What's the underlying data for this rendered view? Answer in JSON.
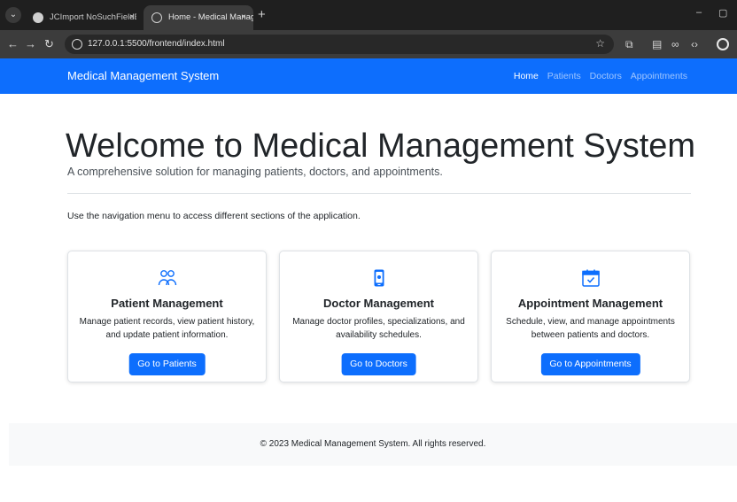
{
  "browser": {
    "tabs": [
      {
        "title": "JCImport NoSuchFieldError Fix",
        "close": "×",
        "active": false
      },
      {
        "title": "Home - Medical Management System",
        "close": "×",
        "active": true
      }
    ],
    "new_tab": "+",
    "url": "127.0.0.1:5500/frontend/index.html",
    "window_controls": {
      "minimize": "–",
      "restore": "▢"
    }
  },
  "navbar": {
    "brand": "Medical Management System",
    "links": [
      "Home",
      "Patients",
      "Doctors",
      "Appointments"
    ],
    "active_link": "Home",
    "color": "#0d6efd"
  },
  "hero": {
    "title": "Welcome to Medical Management System",
    "subtitle": "A comprehensive solution for managing patients, doctors, and appointments."
  },
  "hint": "Use the navigation menu to access different sections of the application.",
  "cards": [
    {
      "icon": "people-icon",
      "title": "Patient Management",
      "text": "Manage patient records, view patient history, and update patient information.",
      "button": "Go to Patients"
    },
    {
      "icon": "phone-badge-icon",
      "title": "Doctor Management",
      "text": "Manage doctor profiles, specializations, and availability schedules.",
      "button": "Go to Doctors"
    },
    {
      "icon": "calendar-check-icon",
      "title": "Appointment Management",
      "text": "Schedule, view, and manage appointments between patients and doctors.",
      "button": "Go to Appointments"
    }
  ],
  "footer": {
    "text": "© 2023 Medical Management System. All rights reserved."
  }
}
